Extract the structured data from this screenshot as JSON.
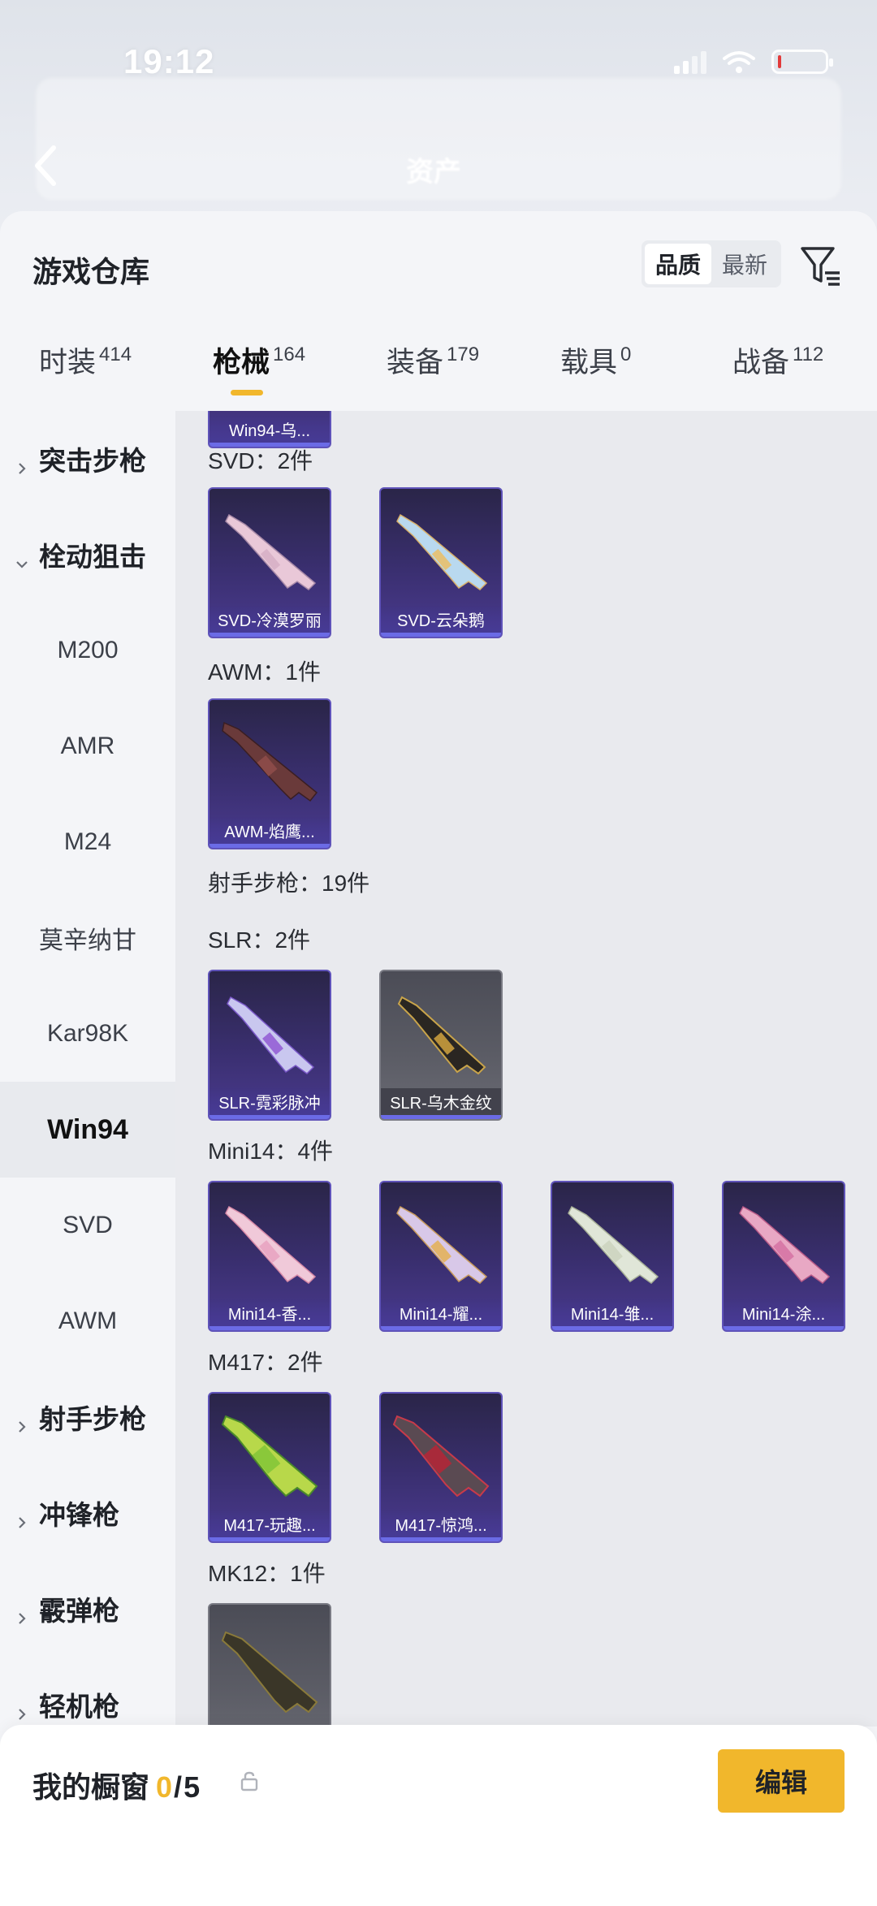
{
  "status_bar": {
    "time": "19:12"
  },
  "background_nav": {
    "active_tab": "资产"
  },
  "sheet": {
    "title": "游戏仓库",
    "sort_options": [
      {
        "label": "品质",
        "selected": true
      },
      {
        "label": "最新",
        "selected": false
      }
    ],
    "tabs": [
      {
        "label": "时装",
        "count": "414",
        "active": false
      },
      {
        "label": "枪械",
        "count": "164",
        "active": true
      },
      {
        "label": "装备",
        "count": "179",
        "active": false
      },
      {
        "label": "载具",
        "count": "0",
        "active": false
      },
      {
        "label": "战备",
        "count": "112",
        "active": false
      }
    ]
  },
  "sidebar": {
    "items": [
      {
        "label": "突击步枪",
        "kind": "group",
        "expanded": false
      },
      {
        "label": "栓动狙击",
        "kind": "group",
        "expanded": true
      },
      {
        "label": "M200",
        "kind": "sub"
      },
      {
        "label": "AMR",
        "kind": "sub"
      },
      {
        "label": "M24",
        "kind": "sub"
      },
      {
        "label": "莫辛纳甘",
        "kind": "sub"
      },
      {
        "label": "Kar98K",
        "kind": "sub"
      },
      {
        "label": "Win94",
        "kind": "sub",
        "selected": true
      },
      {
        "label": "SVD",
        "kind": "sub"
      },
      {
        "label": "AWM",
        "kind": "sub"
      },
      {
        "label": "射手步枪",
        "kind": "group",
        "expanded": false
      },
      {
        "label": "冲锋枪",
        "kind": "group",
        "expanded": false
      },
      {
        "label": "霰弹枪",
        "kind": "group",
        "expanded": false
      },
      {
        "label": "轻机枪",
        "kind": "group",
        "expanded": false
      }
    ]
  },
  "content": {
    "top_partial_card": "Win94-乌...",
    "sections": [
      {
        "label": "SVD：2件",
        "cards": [
          "SVD-冷漠罗丽",
          "SVD-云朵鹅"
        ]
      },
      {
        "label": "AWM：1件",
        "cards": [
          "AWM-焰鹰..."
        ]
      },
      {
        "label": "射手步枪：19件",
        "cards": []
      },
      {
        "label": "SLR：2件",
        "cards": [
          "SLR-霓彩脉冲",
          "SLR-乌木金纹"
        ]
      },
      {
        "label": "Mini14：4件",
        "cards": [
          "Mini14-香...",
          "Mini14-耀...",
          "Mini14-雏...",
          "Mini14-涂..."
        ]
      },
      {
        "label": "M417：2件",
        "cards": [
          "M417-玩趣...",
          "M417-惊鸿..."
        ]
      },
      {
        "label": "MK12：1件",
        "cards": []
      }
    ]
  },
  "bottom_bar": {
    "title": "我的橱窗",
    "current": "0",
    "max": "5",
    "edit_label": "编辑"
  },
  "colors": {
    "accent": "#f1b72c",
    "card_purple": "#3a2f70",
    "card_grey": "#5c5d66",
    "caption_underline": "#6b6be6"
  }
}
